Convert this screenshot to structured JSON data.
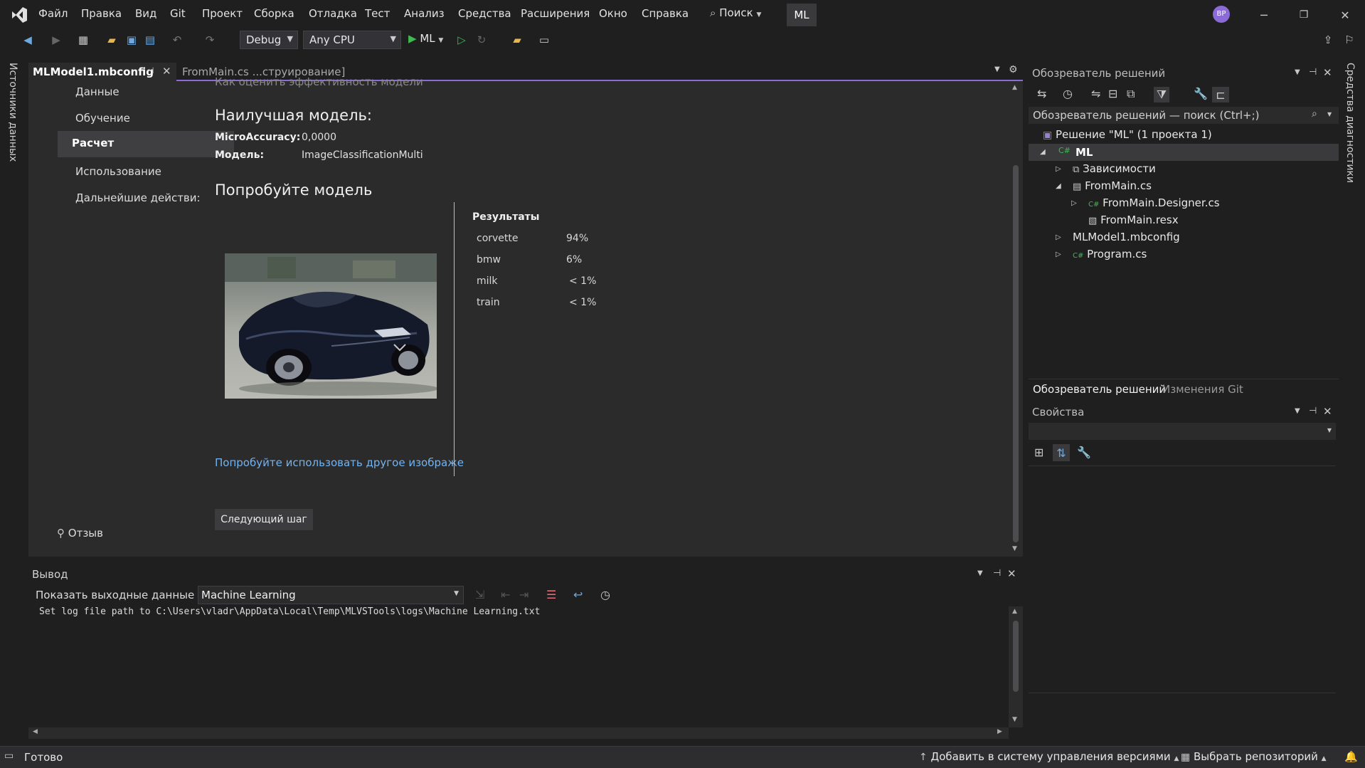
{
  "app": {
    "logo_icon": "visual-studio-logo-icon",
    "title": "ML",
    "avatar": "ВР"
  },
  "menu": [
    "Файл",
    "Правка",
    "Вид",
    "Git",
    "Проект",
    "Сборка",
    "Отладка",
    "Тест",
    "Анализ",
    "Средства",
    "Расширения",
    "Окно",
    "Справка"
  ],
  "search_label": "Поиск",
  "toolbar": {
    "config": "Debug",
    "platform": "Any CPU",
    "run_target": "ML"
  },
  "side_left_tab": "Источники данных",
  "side_right_tab": "Средства диагностики",
  "tabs": [
    {
      "label": "MLModel1.mbconfig",
      "active": true
    },
    {
      "label": "FromMain.cs ...струирование]",
      "active": false
    }
  ],
  "editor": {
    "clipped_text": "Как оценить эффективность модели",
    "nav": [
      "Данные",
      "Обучение",
      "Расчет",
      "Использование",
      "Дальнейшие действи:"
    ],
    "nav_selected": 2,
    "feedback": "Отзыв",
    "best_model_title": "Наилучшая модель:",
    "metric_label": "MicroAccuracy:",
    "metric_value": "0,0000",
    "model_label": "Модель:",
    "model_value": "ImageClassificationMulti",
    "try_title": "Попробуйте модель",
    "results_title": "Результаты",
    "results": [
      {
        "label": "corvette",
        "value": "94%"
      },
      {
        "label": "bmw",
        "value": "6%"
      },
      {
        "label": "milk",
        "value": "< 1%"
      },
      {
        "label": "train",
        "value": "< 1%"
      }
    ],
    "try_other_link": "Попробуйте использовать другое изображе",
    "next_button": "Следующий шаг"
  },
  "solution_explorer": {
    "title": "Обозреватель решений",
    "search_placeholder": "Обозреватель решений — поиск (Ctrl+;)",
    "items": [
      {
        "label": "Решение \"ML\"  (1 проекта 1)",
        "icon": "solution-icon"
      },
      {
        "label": "ML",
        "icon": "csharp-project-icon"
      },
      {
        "label": "Зависимости",
        "icon": "dependencies-icon"
      },
      {
        "label": "FromMain.cs",
        "icon": "form-icon"
      },
      {
        "label": "FromMain.Designer.cs",
        "icon": "csharp-file-icon"
      },
      {
        "label": "FromMain.resx",
        "icon": "resx-file-icon"
      },
      {
        "label": "MLModel1.mbconfig",
        "icon": "mbconfig-file-icon"
      },
      {
        "label": "Program.cs",
        "icon": "csharp-file-icon"
      }
    ],
    "tab_solution": "Обозреватель решений",
    "tab_git": "Изменения Git"
  },
  "properties": {
    "title": "Свойства"
  },
  "output": {
    "title": "Вывод",
    "show_from_label": "Показать выходные данные из:",
    "source": "Machine Learning",
    "log": "Set log file path to C:\\Users\\vladr\\AppData\\Local\\Temp\\MLVSTools\\logs\\Machine Learning.txt"
  },
  "status": {
    "ready": "Готово",
    "add_vcs": "Добавить в систему управления версиями",
    "select_repo": "Выбрать репозиторий"
  },
  "colors": {
    "accent": "#8a6bd8",
    "run_green": "#3fb950",
    "link": "#73b3f0",
    "badge_bg": "#3a3a3d"
  }
}
